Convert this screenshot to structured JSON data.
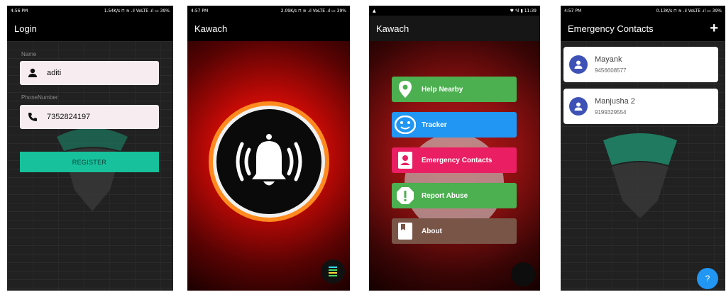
{
  "screens": {
    "login": {
      "status": {
        "time": "4:56 PM",
        "right": "1.54K/s ⊓ ≋ .ıl VoLTE .ıl ▭ 39%"
      },
      "title": "Login",
      "name_label": "Name",
      "name_value": "aditi",
      "phone_label": "PhoneNumber",
      "phone_value": "7352824197",
      "register_label": "REGISTER"
    },
    "home": {
      "status": {
        "time": "4:57 PM",
        "right": "2.09K/s ⊓ ≋ .ıl VoLTE .ıl ▭ 39%"
      },
      "title": "Kawach",
      "center_icon": "bell-alarm-icon",
      "fab_icon": "menu-lines-icon"
    },
    "menu": {
      "status": {
        "left": "▲",
        "right": "♥ ⁴ıl ▮ 11:39"
      },
      "title": "Kawach",
      "items": [
        {
          "label": "Help Nearby",
          "icon": "location-pin-icon",
          "color": "#4caf50"
        },
        {
          "label": "Tracker",
          "icon": "smiley-face-icon",
          "color": "#2196f3"
        },
        {
          "label": "Emergency Contacts",
          "icon": "contact-card-icon",
          "color": "#e91e63"
        },
        {
          "label": "Report Abuse",
          "icon": "alert-octagon-icon",
          "color": "#4caf50"
        },
        {
          "label": "About",
          "icon": "bookmark-icon",
          "color": "#795548"
        }
      ]
    },
    "contacts": {
      "status": {
        "time": "4:57 PM",
        "right": "0.13K/s ⊓ ≋ .ıl VoLTE .ıl ▭ 39%"
      },
      "title": "Emergency Contacts",
      "add_icon": "+",
      "contacts": [
        {
          "name": "Mayank",
          "phone": "9456608577"
        },
        {
          "name": "Manjusha 2",
          "phone": "9199329554"
        }
      ],
      "help_fab": "?"
    }
  },
  "colors": {
    "accent_teal": "#16c19c",
    "field_bg": "#f7ecef",
    "avatar_blue": "#3d51b6",
    "fab_blue": "#2196f3"
  }
}
